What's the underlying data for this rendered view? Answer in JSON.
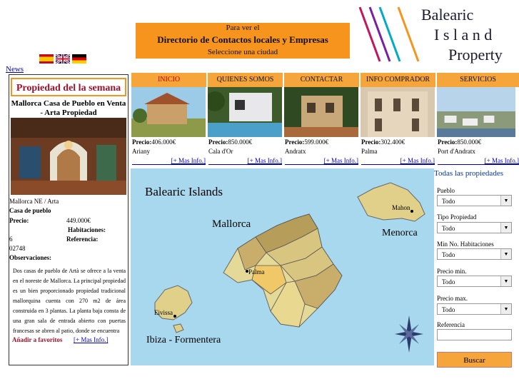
{
  "banner": {
    "line1": "Para ver el",
    "line2": "Directorio de Contactos locales y Empresas",
    "line3": "Seleccione una ciudad"
  },
  "logo": {
    "word1": "Balearic",
    "word2": "I s l a n d",
    "word3": "Property"
  },
  "news_link": "News",
  "left_panel": {
    "header": "Propiedad del la semana",
    "property_name": "Mallorca Casa de Pueblo en Venta - Arta Propiedad",
    "location": "Mallorca NE / Arta",
    "type": "Casa de pueblo",
    "price_label": "Precio:",
    "price_value": "449.000€",
    "rooms_label": "Habitaciones:",
    "rooms_value": "6",
    "ref_label": "Referencia:",
    "ref_value": "02748",
    "obs_label": "Observaciones:",
    "obs_text": "Dos casas de pueblo de Artà se ofrece a la venta en el noreste de Mallorca. La principal propiedad es un bien proporcionado propiedad tradicional mallorquina cuenta con 270 m2 de área construida en 3 plantas. La planta baja consta de una gran sala de entrada abierto con puertas francesas se abren al patio, donde se encuentra",
    "favorites": "Añadir a favoritos",
    "more_info": "[+ Mas Info.]"
  },
  "nav": [
    {
      "label": "INICIO"
    },
    {
      "label": "QUIENES SOMOS"
    },
    {
      "label": "CONTACTAR"
    },
    {
      "label": "INFO COMPRADOR"
    },
    {
      "label": "SERVICIOS"
    }
  ],
  "cards": [
    {
      "price_label": "Precio:",
      "price": "406.000€",
      "location": "Ariany",
      "more": "[+ Mas Info.]"
    },
    {
      "price_label": "Precio:",
      "price": "850.000€",
      "location": "Cala d'Or",
      "more": "[+ Mas Info.]"
    },
    {
      "price_label": "Precio:",
      "price": "599.000€",
      "location": "Andratx",
      "more": "[+ Mas Info.]"
    },
    {
      "price_label": "Precio:",
      "price": "302.400€",
      "location": "Palma",
      "more": "[+ Mas Info.]"
    },
    {
      "price_label": "Precio:",
      "price": "850.000€",
      "location": "Port d'Andratx",
      "more": "[+ Mas Info.]"
    }
  ],
  "map": {
    "title": "Balearic Islands",
    "mallorca": "Mallorca",
    "menorca": "Menorca",
    "mahon": "Mahon",
    "palma": "Palma",
    "eivissa": "Eivissa",
    "ibiza": "Ibiza - Formentera",
    "compass": "N"
  },
  "search": {
    "all_properties": "Todas las propiedades",
    "pueblo_label": "Pueblo",
    "pueblo_value": "Todo",
    "tipo_label": "Tipo Propiedad",
    "tipo_value": "Todo",
    "hab_label": "Min No. Habitaciones",
    "hab_value": "Todo",
    "pmin_label": "Precio min.",
    "pmin_value": "Todo",
    "pmax_label": "Precio max.",
    "pmax_value": "Todo",
    "ref_label": "Referencia",
    "ref_value": "",
    "button": "Buscar"
  },
  "colors": {
    "accent": "#f7941d",
    "nav": "#f5a53a",
    "link": "#0000cc",
    "title_red": "#a0102a"
  }
}
